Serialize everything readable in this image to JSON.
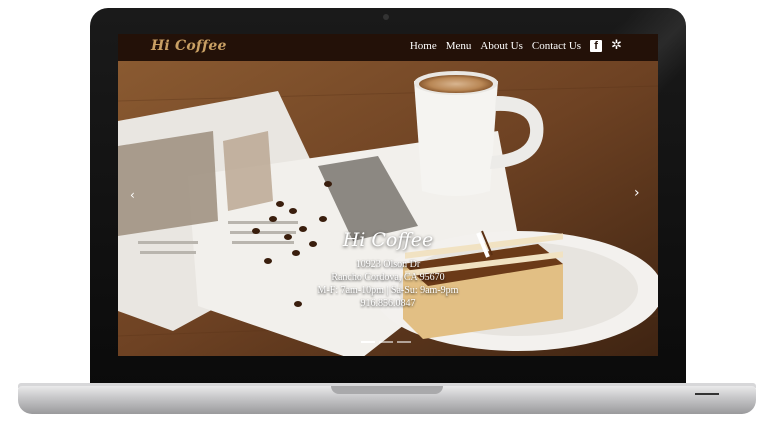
{
  "site": {
    "brand": "Hi Coffee",
    "nav": [
      "Home",
      "Menu",
      "About Us",
      "Contact Us"
    ],
    "social": {
      "facebook_icon": "facebook-icon",
      "yelp_icon": "yelp-icon"
    }
  },
  "hero": {
    "brand": "Hi Coffee",
    "address1": "10923 Olson Dr",
    "address2": "Rancho Cordova, CA 95670",
    "hours": "M-F: 7am-10pm | Sa-Su: 9am-9pm",
    "phone": "916.856.0847",
    "prev_arrow": "‹",
    "next_arrow": "›",
    "slides": 3,
    "active_slide": 1
  },
  "colors": {
    "navbar": "#231108",
    "brand": "#c9a064",
    "table": "#7a4a26"
  }
}
